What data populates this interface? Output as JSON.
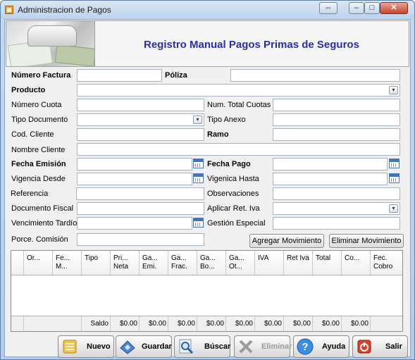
{
  "window": {
    "title": "Administracion de Pagos",
    "restore_glyph": "⇔",
    "minimize_glyph": "–",
    "maximize_glyph": "□",
    "close_glyph": "✕"
  },
  "banner": {
    "title": "Registro Manual Pagos Primas de Seguros"
  },
  "form": {
    "numero_factura": {
      "label": "Número Factura",
      "value": ""
    },
    "poliza": {
      "label": "Póliza",
      "value": ""
    },
    "producto": {
      "label": "Producto",
      "value": ""
    },
    "numero_cuota": {
      "label": "Número Cuota",
      "value": ""
    },
    "num_total_cuotas": {
      "label": "Num. Total Cuotas",
      "value": ""
    },
    "tipo_documento": {
      "label": "Tipo Documento",
      "value": ""
    },
    "tipo_anexo": {
      "label": "Tipo Anexo",
      "value": ""
    },
    "cod_cliente": {
      "label": "Cod. Cliente",
      "value": ""
    },
    "ramo": {
      "label": "Ramo",
      "value": ""
    },
    "nombre_cliente": {
      "label": "Nombre Cliente",
      "value": ""
    },
    "fecha_emision": {
      "label": "Fecha Emisión",
      "value": ""
    },
    "fecha_pago": {
      "label": "Fecha Pago",
      "value": ""
    },
    "vigencia_desde": {
      "label": "Vigencia Desde",
      "value": ""
    },
    "vigencia_hasta": {
      "label": "Vigenica Hasta",
      "value": ""
    },
    "referencia": {
      "label": "Referencia",
      "value": ""
    },
    "observaciones": {
      "label": "Observaciones",
      "value": ""
    },
    "documento_fiscal": {
      "label": "Documento Fiscal",
      "value": ""
    },
    "aplicar_ret_iva": {
      "label": "Aplicar Ret. Iva",
      "value": ""
    },
    "vencimiento_tardio": {
      "label": "Vencimiento Tardío",
      "value": ""
    },
    "gestion_especial": {
      "label": "Gestión Especial",
      "value": ""
    },
    "porce_comision": {
      "label": "Porce. Comisión",
      "value": ""
    }
  },
  "actions": {
    "agregar_movimiento": "Agregar Movimiento",
    "eliminar_movimiento": "Eliminar Movimiento"
  },
  "grid": {
    "columns": [
      "Or...",
      "Fe... M...",
      "Tipo",
      "Pri... Neta",
      "Ga... Emi.",
      "Ga... Frac.",
      "Ga... Bo...",
      "Ga... Ot...",
      "IVA",
      "Ret Iva",
      "Total",
      "Co...",
      "Fec. Cobro"
    ],
    "rows": [],
    "footer": [
      "",
      "",
      "Saldo",
      "$0.00",
      "$0.00",
      "$0.00",
      "$0.00",
      "$0.00",
      "$0.00",
      "$0.00",
      "$0.00",
      "$0.00",
      ""
    ]
  },
  "toolbar": {
    "nuevo": "Nuevo",
    "guardar": "Guardar",
    "buscar": "Búscar",
    "eliminar": "Eliminar",
    "ayuda": "Ayuda",
    "salir": "Salir"
  },
  "icons": {
    "nuevo": "new-record-icon",
    "guardar": "save-icon",
    "buscar": "search-icon",
    "eliminar": "delete-icon",
    "ayuda": "help-icon",
    "salir": "exit-icon"
  }
}
